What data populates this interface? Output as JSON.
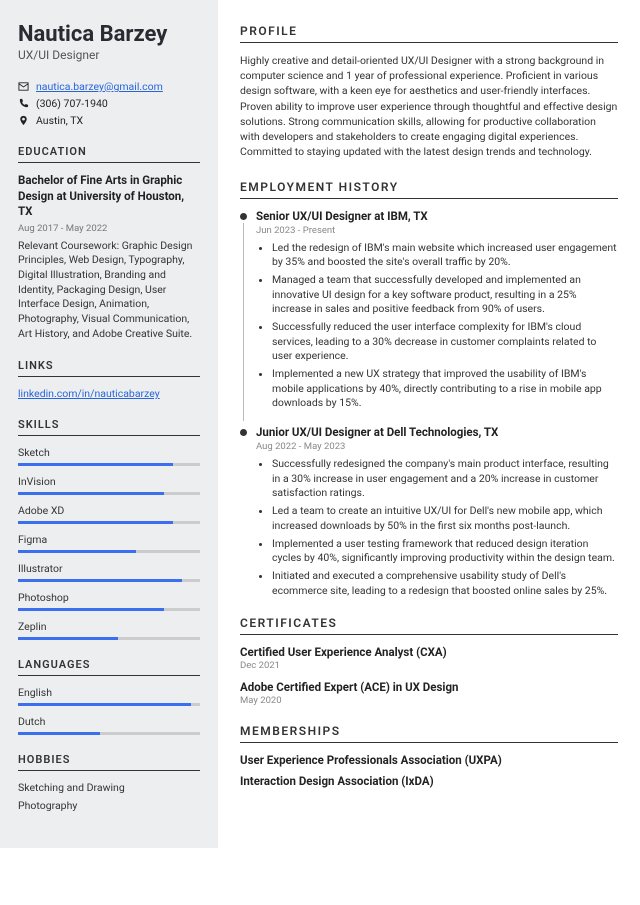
{
  "name": "Nautica Barzey",
  "title": "UX/UI Designer",
  "contact": {
    "email": "nautica.barzey@gmail.com",
    "phone": "(306) 707-1940",
    "location": "Austin, TX"
  },
  "sections": {
    "education": "EDUCATION",
    "links": "LINKS",
    "skills": "SKILLS",
    "languages": "LANGUAGES",
    "hobbies": "HOBBIES",
    "profile": "PROFILE",
    "employment": "EMPLOYMENT HISTORY",
    "certificates": "CERTIFICATES",
    "memberships": "MEMBERSHIPS"
  },
  "education": {
    "degree": "Bachelor of Fine Arts in Graphic Design at University of Houston, TX",
    "dates": "Aug 2017 - May 2022",
    "coursework": "Relevant Coursework: Graphic Design Principles, Web Design, Typography, Digital Illustration, Branding and Identity, Packaging Design, User Interface Design, Animation, Photography, Visual Communication, Art History, and Adobe Creative Suite."
  },
  "links": {
    "linkedin": "linkedin.com/in/nauticabarzey"
  },
  "skills": [
    {
      "name": "Sketch",
      "level": 85
    },
    {
      "name": "InVision",
      "level": 80
    },
    {
      "name": "Adobe XD",
      "level": 85
    },
    {
      "name": "Figma",
      "level": 65
    },
    {
      "name": "Illustrator",
      "level": 90
    },
    {
      "name": "Photoshop",
      "level": 80
    },
    {
      "name": "Zeplin",
      "level": 55
    }
  ],
  "languages": [
    {
      "name": "English",
      "level": 95
    },
    {
      "name": "Dutch",
      "level": 45
    }
  ],
  "hobbies": [
    "Sketching and Drawing",
    "Photography"
  ],
  "profile": "Highly creative and detail-oriented UX/UI Designer with a strong background in computer science and 1 year of professional experience. Proficient in various design software, with a keen eye for aesthetics and user-friendly interfaces. Proven ability to improve user experience through thoughtful and effective design solutions. Strong communication skills, allowing for productive collaboration with developers and stakeholders to create engaging digital experiences. Committed to staying updated with the latest design trends and technology.",
  "jobs": [
    {
      "title": "Senior UX/UI Designer at IBM, TX",
      "dates": "Jun 2023 - Present",
      "bullets": [
        "Led the redesign of IBM's main website which increased user engagement by 35% and boosted the site's overall traffic by 20%.",
        "Managed a team that successfully developed and implemented an innovative UI design for a key software product, resulting in a 25% increase in sales and positive feedback from 90% of users.",
        "Successfully reduced the user interface complexity for IBM's cloud services, leading to a 30% decrease in customer complaints related to user experience.",
        "Implemented a new UX strategy that improved the usability of IBM's mobile applications by 40%, directly contributing to a rise in mobile app downloads by 15%."
      ]
    },
    {
      "title": "Junior UX/UI Designer at Dell Technologies, TX",
      "dates": "Aug 2022 - May 2023",
      "bullets": [
        "Successfully redesigned the company's main product interface, resulting in a 30% increase in user engagement and a 20% increase in customer satisfaction ratings.",
        "Led a team to create an intuitive UX/UI for Dell's new mobile app, which increased downloads by 50% in the first six months post-launch.",
        "Implemented a user testing framework that reduced design iteration cycles by 40%, significantly improving productivity within the design team.",
        "Initiated and executed a comprehensive usability study of Dell's ecommerce site, leading to a redesign that boosted online sales by 25%."
      ]
    }
  ],
  "certificates": [
    {
      "title": "Certified User Experience Analyst (CXA)",
      "date": "Dec 2021"
    },
    {
      "title": "Adobe Certified Expert (ACE) in UX Design",
      "date": "May 2020"
    }
  ],
  "memberships": [
    "User Experience Professionals Association (UXPA)",
    "Interaction Design Association (IxDA)"
  ]
}
